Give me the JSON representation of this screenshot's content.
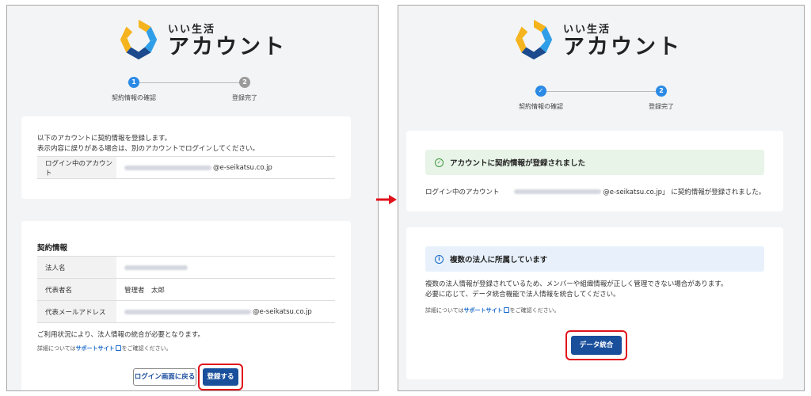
{
  "logo": {
    "line1": "いい生活",
    "line2": "アカウント"
  },
  "steps": [
    {
      "number": "1",
      "label": "契約情報の確認"
    },
    {
      "number": "2",
      "label": "登録完了"
    }
  ],
  "left": {
    "intro_line1": "以下のアカウントに契約情報を登録します。",
    "intro_line2": "表示内容に誤りがある場合は、別のアカウントでログインしてください。",
    "account_label": "ログイン中のアカウント",
    "account_domain": "@e-seikatsu.co.jp",
    "contract_title": "契約情報",
    "rows": [
      {
        "label": "法人名",
        "value": ""
      },
      {
        "label": "代表者名",
        "value": "管理者　太郎"
      },
      {
        "label": "代表メールアドレス",
        "value": "@e-seikatsu.co.jp"
      }
    ],
    "merge_note": "ご利用状況により、法人情報の統合が必要となります。",
    "detail_prefix": "詳細については",
    "support_link": "サポートサイト",
    "detail_suffix": "をご確認ください。",
    "back_button": "ログイン画面に戻る",
    "register_button": "登録する"
  },
  "right": {
    "success_banner": "アカウントに契約情報が登録されました",
    "login_prefix": "ログイン中のアカウント",
    "login_domain": "@e-seikatsu.co.jp」",
    "login_suffix": "に契約情報が登録されました。",
    "info_banner": "複数の法人に所属しています",
    "info_line1": "複数の法人情報が登録されているため、メンバーや組織情報が正しく管理できない場合があります。",
    "info_line2": "必要に応じて、データ統合機能で法人情報を統合してください。",
    "detail_prefix": "詳細については",
    "support_link": "サポートサイト",
    "detail_suffix": "をご確認ください。",
    "merge_button": "データ統合"
  },
  "colors": {
    "primary": "#1a4f9c",
    "step_active": "#2b8ae6",
    "step_inactive": "#9a9a9a",
    "highlight": "#e0121b",
    "success_bg": "#e8f4e8",
    "info_bg": "#e8f1fb"
  },
  "icons": [
    "logo-hexagon-icon",
    "check-circle-icon",
    "info-circle-icon",
    "external-link-icon",
    "arrow-right-icon"
  ]
}
